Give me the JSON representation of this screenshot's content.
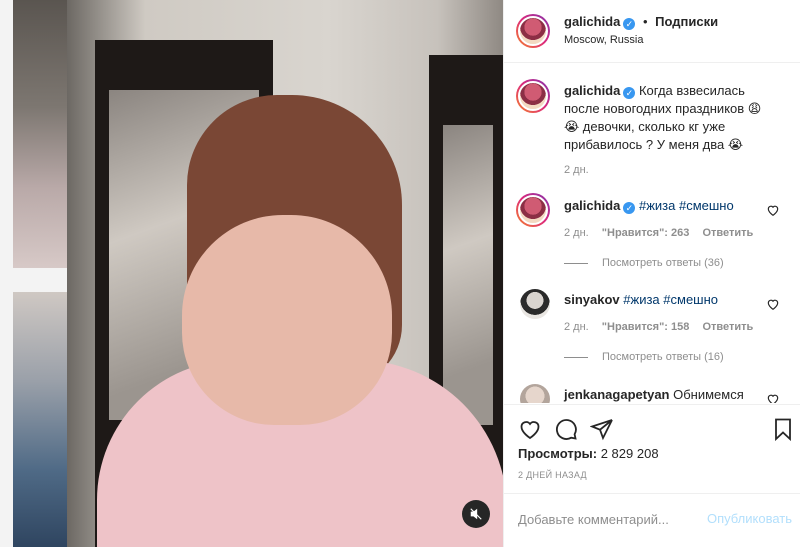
{
  "header": {
    "username": "galichida",
    "follow_label": "Подписки",
    "location": "Moscow, Russia"
  },
  "caption": {
    "username": "galichida",
    "text": "Когда взвесилась после новогодних праздников 😩😭 девочки, сколько кг уже прибавилось ? У меня два 😭",
    "time": "2 дн."
  },
  "comments": [
    {
      "username": "galichida",
      "text": "#жиза #смешно",
      "time": "2 дн.",
      "likes": "\"Нравится\": 263",
      "reply_label": "Ответить",
      "view_replies": "Посмотреть ответы (36)"
    },
    {
      "username": "sinyakov",
      "text": "#жиза #смешно",
      "time": "2 дн.",
      "likes": "\"Нравится\": 158",
      "reply_label": "Ответить",
      "view_replies": "Посмотреть ответы (16)"
    },
    {
      "username": "jenkanagapetyan",
      "text": "Обнимемся"
    }
  ],
  "stats": {
    "views_label": "Просмотры:",
    "views_value": "2 829 208",
    "date": "2 ДНЕЙ НАЗАД"
  },
  "add_comment": {
    "placeholder": "Добавьте комментарий...",
    "publish_label": "Опубликовать"
  },
  "icons": {
    "verified": "verified-badge-icon",
    "like": "heart-icon",
    "comment": "comment-icon",
    "share": "share-icon",
    "save": "bookmark-icon",
    "mute": "mute-icon"
  },
  "colors": {
    "accent": "#3897f0",
    "link": "#00376b",
    "muted": "#8e8e8e",
    "publish_disabled": "#b2dffc"
  }
}
